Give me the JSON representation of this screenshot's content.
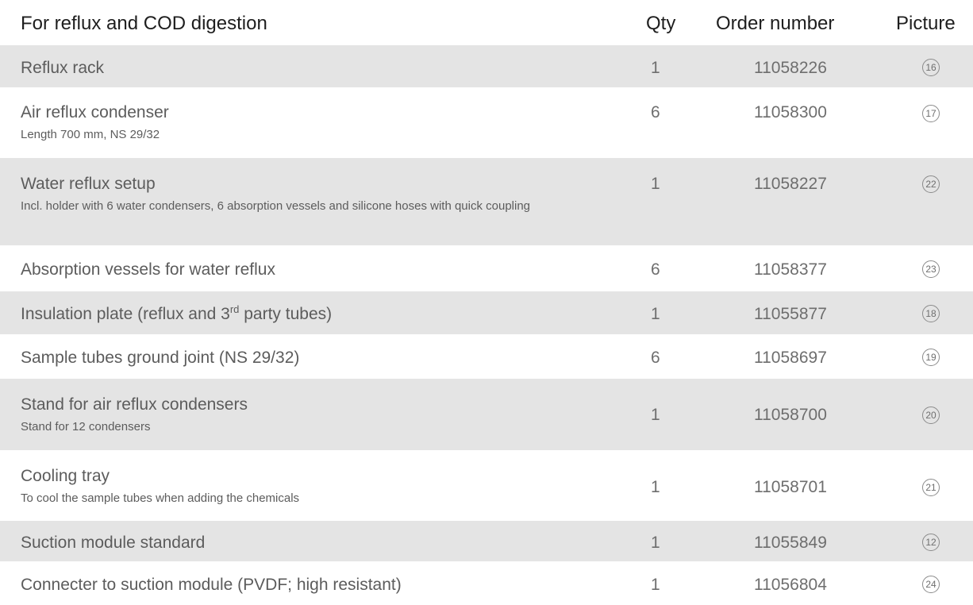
{
  "header": {
    "title": "For reflux and COD digestion",
    "qty": "Qty",
    "order_number": "Order number",
    "picture": "Picture"
  },
  "rows": [
    {
      "name": "Reflux rack",
      "sub": "",
      "qty": "1",
      "order": "11058226",
      "picture": "16"
    },
    {
      "name": "Air reflux condenser",
      "sub": "Length 700 mm, NS 29/32",
      "qty": "6",
      "order": "11058300",
      "picture": "17"
    },
    {
      "name": "Water reflux setup",
      "sub": "Incl. holder with 6 water condensers, 6 absorption vessels and silicone hoses with quick coupling",
      "qty": "1",
      "order": "11058227",
      "picture": "22"
    },
    {
      "name": "Absorption vessels for water reflux",
      "sub": "",
      "qty": "6",
      "order": "11058377",
      "picture": "23"
    },
    {
      "name_pre": "Insulation plate (reflux and 3",
      "name_sup": "rd",
      "name_post": " party tubes)",
      "sub": "",
      "qty": "1",
      "order": "11055877",
      "picture": "18"
    },
    {
      "name": "Sample tubes ground joint (NS 29/32)",
      "sub": "",
      "qty": "6",
      "order": "11058697",
      "picture": "19"
    },
    {
      "name": "Stand for air reflux condensers",
      "sub": "Stand for 12 condensers",
      "qty": "1",
      "order": "11058700",
      "picture": "20"
    },
    {
      "name": "Cooling tray",
      "sub": "To cool the sample tubes when adding the chemicals",
      "qty": "1",
      "order": "11058701",
      "picture": "21"
    },
    {
      "name": "Suction module standard",
      "sub": "",
      "qty": "1",
      "order": "11055849",
      "picture": "12"
    },
    {
      "name": "Connecter to suction module (PVDF; high resistant)",
      "sub": "",
      "qty": "1",
      "order": "11056804",
      "picture": "24"
    }
  ]
}
